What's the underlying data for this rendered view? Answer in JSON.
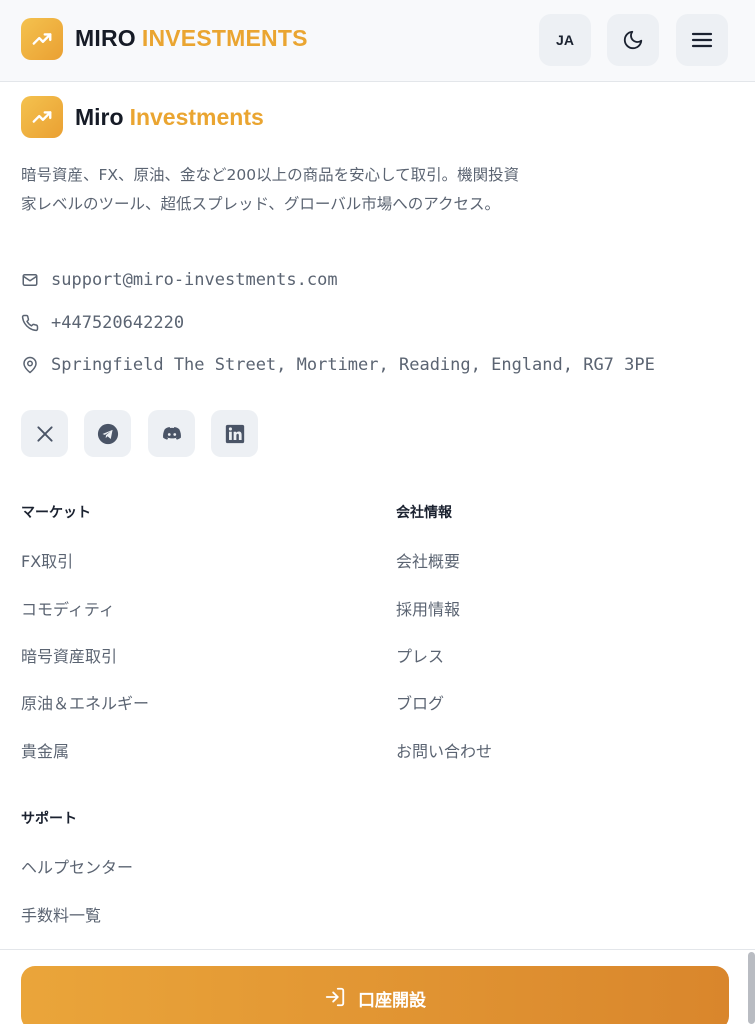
{
  "header": {
    "brand_part1": "MIRO",
    "brand_part2": "INVESTMENTS",
    "lang_label": "JA",
    "icons": [
      "trend-up-icon",
      "moon-icon",
      "hamburger-menu-icon"
    ]
  },
  "company": {
    "brand_part1": "Miro",
    "brand_part2": "Investments",
    "description": "暗号資産、FX、原油、金など200以上の商品を安心して取引。機関投資家レベルのツール、超低スプレッド、グローバル市場へのアクセス。",
    "email": "support@miro-investments.com",
    "phone": "+447520642220",
    "address": "Springfield The Street, Mortimer, Reading, England, RG7 3PE"
  },
  "social": [
    "x-icon",
    "telegram-icon",
    "discord-icon",
    "linkedin-icon"
  ],
  "columns": {
    "markets": {
      "title": "マーケット",
      "links": [
        "FX取引",
        "コモディティ",
        "暗号資産取引",
        "原油＆エネルギー",
        "貴金属"
      ]
    },
    "company": {
      "title": "会社情報",
      "links": [
        "会社概要",
        "採用情報",
        "プレス",
        "ブログ",
        "お問い合わせ"
      ]
    },
    "support": {
      "title": "サポート",
      "links": [
        "ヘルプセンター",
        "手数料一覧"
      ]
    }
  },
  "cta": {
    "label": "口座開設",
    "icon": "login-icon"
  },
  "colors": {
    "accent": "#eaa531",
    "cta_start": "#eaa53a",
    "cta_end": "#d9862c",
    "text_muted": "#5b6472"
  }
}
